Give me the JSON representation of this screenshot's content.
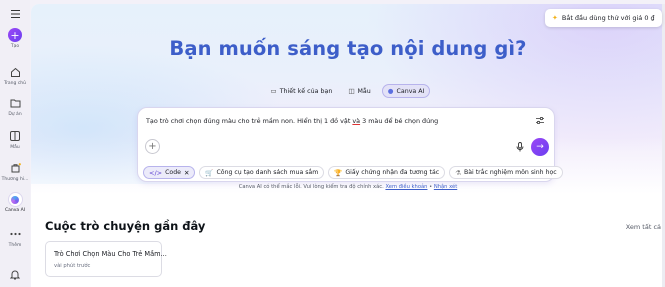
{
  "rail": {
    "menu_icon": "hamburger-icon",
    "items": [
      {
        "label": "Tạo",
        "icon": "plus-icon"
      },
      {
        "label": "Trang chủ",
        "icon": "home-icon"
      },
      {
        "label": "Dự án",
        "icon": "folder-icon"
      },
      {
        "label": "Mẫu",
        "icon": "template-icon"
      },
      {
        "label": "Thương hi...",
        "icon": "brand-icon"
      },
      {
        "label": "Canva AI",
        "icon": "canva-ai-icon"
      },
      {
        "label": "Thêm",
        "icon": "more-icon"
      }
    ],
    "bell_icon": "bell-icon"
  },
  "header": {
    "trial_label": "Bắt đầu dùng thử với giá 0 ₫"
  },
  "hero": {
    "headline": "Bạn muốn sáng tạo nội dung gì?",
    "tabs": [
      {
        "label": "Thiết kế của bạn",
        "icon": "design-icon"
      },
      {
        "label": "Mẫu",
        "icon": "template-icon"
      },
      {
        "label": "Canva AI",
        "icon": "canva-ai-icon",
        "selected": true
      }
    ]
  },
  "prompt": {
    "text_before": "Tạo trò chơi chọn đúng màu cho trẻ mầm non. Hiển thị 1 đồ vật ",
    "text_underlined": "và",
    "text_after": " 3 màu để bé chọn đúng",
    "chips": [
      {
        "label": "Code",
        "icon": "code-icon",
        "selected": true,
        "removable": true
      },
      {
        "label": "Công cụ tạo danh sách mua sắm",
        "icon": "cart-icon"
      },
      {
        "label": "Giấy chứng nhận đa tương tác",
        "icon": "certificate-icon"
      },
      {
        "label": "Bài trắc nghiệm môn sinh học",
        "icon": "quiz-icon"
      }
    ]
  },
  "disclaimer": {
    "text": "Canva AI có thể mắc lỗi. Vui lòng kiểm tra độ chính xác. ",
    "terms_link": "Xem điều khoản",
    "separator": " • ",
    "feedback_link": "Nhận xét"
  },
  "recent": {
    "title": "Cuộc trò chuyện gần đây",
    "see_all": "Xem tất cả",
    "items": [
      {
        "title": "Trò Chơi Chọn Màu Cho Trẻ Mầm...",
        "subtitle": "vài phút trước"
      }
    ]
  },
  "colors": {
    "accent": "#7d2ae8",
    "headline": "#3d5ec9"
  }
}
